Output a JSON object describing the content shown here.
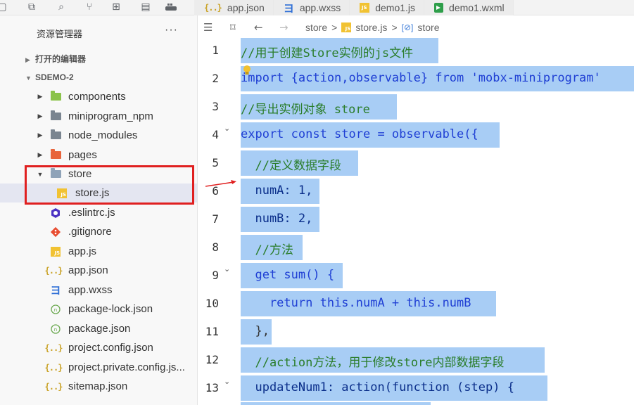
{
  "toolbar": {
    "icons": [
      "screen-icon",
      "copy-icon",
      "search-icon",
      "branch-icon",
      "extensions-icon",
      "layout-icon",
      "container-icon"
    ]
  },
  "tabs": [
    {
      "label": "app.json",
      "icon": "json-icon"
    },
    {
      "label": "app.wxss",
      "icon": "css-icon"
    },
    {
      "label": "demo1.js",
      "icon": "js-icon"
    },
    {
      "label": "demo1.wxml",
      "icon": "wxml-icon"
    }
  ],
  "sidebar": {
    "title": "资源管理器",
    "more": "···",
    "open_editors": "打开的编辑器",
    "project": "SDEMO-2",
    "items": [
      {
        "label": "components",
        "type": "folder",
        "color": "#8bc34a"
      },
      {
        "label": "miniprogram_npm",
        "type": "folder",
        "color": "#7a8590"
      },
      {
        "label": "node_modules",
        "type": "folder",
        "color": "#7a8590"
      },
      {
        "label": "pages",
        "type": "folder",
        "color": "#e8643b"
      },
      {
        "label": "store",
        "type": "folder-open",
        "color": "#8fa3b8"
      },
      {
        "label": "store.js",
        "type": "js"
      },
      {
        "label": ".eslintrc.js",
        "type": "eslint"
      },
      {
        "label": ".gitignore",
        "type": "git"
      },
      {
        "label": "app.js",
        "type": "js"
      },
      {
        "label": "app.json",
        "type": "json"
      },
      {
        "label": "app.wxss",
        "type": "css"
      },
      {
        "label": "package-lock.json",
        "type": "npm"
      },
      {
        "label": "package.json",
        "type": "npm"
      },
      {
        "label": "project.config.json",
        "type": "json"
      },
      {
        "label": "project.private.config.js...",
        "type": "json"
      },
      {
        "label": "sitemap.json",
        "type": "json"
      }
    ]
  },
  "breadcrumb": {
    "items": [
      "store",
      "store.js",
      "store"
    ],
    "separator": ">"
  },
  "code": {
    "lines": [
      {
        "n": "1",
        "text": "//用于创建Store实例的js文件"
      },
      {
        "n": "2",
        "text": "import {action,observable} from 'mobx-miniprogram'"
      },
      {
        "n": "3",
        "text": "//导出实例对象 store"
      },
      {
        "n": "4",
        "text": "export const store = observable({"
      },
      {
        "n": "5",
        "text": "  //定义数据字段"
      },
      {
        "n": "6",
        "text": "  numA: 1,"
      },
      {
        "n": "7",
        "text": "  numB: 2,"
      },
      {
        "n": "8",
        "text": "  //方法"
      },
      {
        "n": "9",
        "text": "  get sum() {"
      },
      {
        "n": "10",
        "text": "    return this.numA + this.numB"
      },
      {
        "n": "11",
        "text": "  },"
      },
      {
        "n": "12",
        "text": "  //action方法，用于修改store内部数据字段"
      },
      {
        "n": "13",
        "text": "  updateNum1: action(function (step) {"
      }
    ]
  },
  "colors": {
    "selection": "#a8cdf5",
    "highlight_box": "#e02020",
    "selected_row": "#e4e6f1"
  }
}
